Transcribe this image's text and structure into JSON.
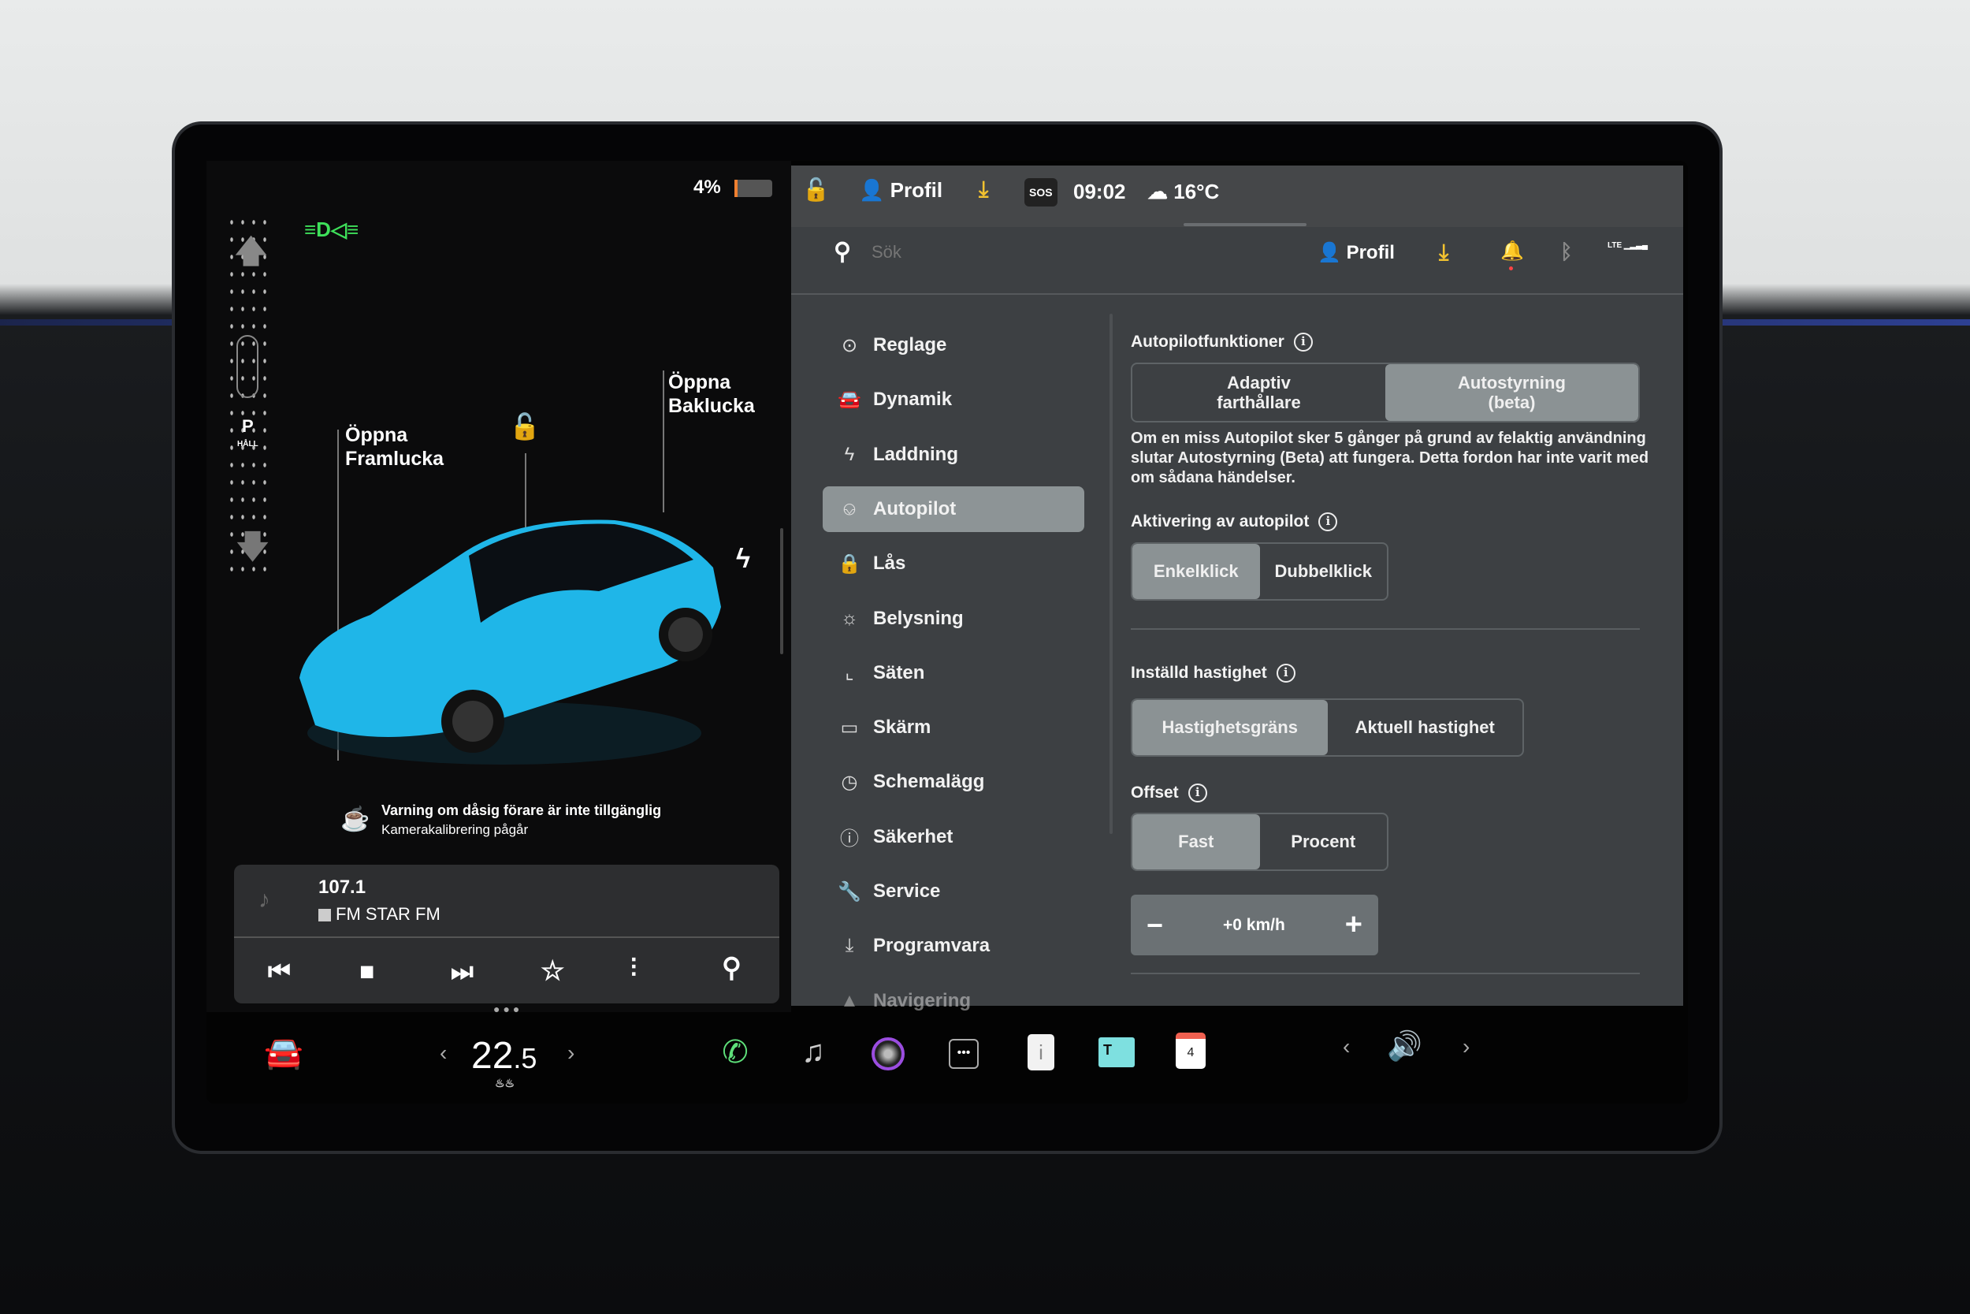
{
  "status": {
    "battery_percent": "4%",
    "battery_level": 4,
    "profile": "Profil",
    "time": "09:02",
    "temperature": "16°C",
    "sos": "SOS"
  },
  "gear": {
    "selected": "P",
    "hold": "HÅLL"
  },
  "car": {
    "front_trunk": [
      "Öppna",
      "Framlucka"
    ],
    "rear_trunk": [
      "Öppna",
      "Baklucka"
    ],
    "color": "#1fb6e8"
  },
  "warning": {
    "title": "Varning om dåsig förare är inte tillgänglig",
    "subtitle": "Kamerakalibrering pågår"
  },
  "media": {
    "frequency": "107.1",
    "station": "FM STAR FM"
  },
  "search": {
    "placeholder": "Sök"
  },
  "header": {
    "profile": "Profil",
    "lte": "LTE"
  },
  "menu": [
    {
      "label": "Reglage",
      "icon": "toggle-icon"
    },
    {
      "label": "Dynamik",
      "icon": "car-icon"
    },
    {
      "label": "Laddning",
      "icon": "bolt-icon"
    },
    {
      "label": "Autopilot",
      "icon": "steering-wheel-icon",
      "active": true
    },
    {
      "label": "Lås",
      "icon": "lock-icon"
    },
    {
      "label": "Belysning",
      "icon": "sun-icon"
    },
    {
      "label": "Säten",
      "icon": "seat-icon"
    },
    {
      "label": "Skärm",
      "icon": "display-icon"
    },
    {
      "label": "Schemalägg",
      "icon": "clock-icon"
    },
    {
      "label": "Säkerhet",
      "icon": "alert-icon"
    },
    {
      "label": "Service",
      "icon": "wrench-icon"
    },
    {
      "label": "Programvara",
      "icon": "download-icon"
    },
    {
      "label": "Navigering",
      "icon": "navigation-icon"
    }
  ],
  "autopilot": {
    "features_title": "Autopilotfunktioner",
    "features": [
      "Adaptiv farthållare",
      "Autostyrning (beta)"
    ],
    "features_selected": 1,
    "description": "Om en miss Autopilot sker 5 gånger på grund av felaktig användning slutar Autostyrning (Beta) att fungera. Detta fordon har inte varit med om sådana händelser.",
    "activation_title": "Aktivering av autopilot",
    "activation": [
      "Enkelklick",
      "Dubbelklick"
    ],
    "activation_selected": 0,
    "speed_title": "Inställd hastighet",
    "speed": [
      "Hastighetsgräns",
      "Aktuell hastighet"
    ],
    "speed_selected": 0,
    "offset_title": "Offset",
    "offset": [
      "Fast",
      "Procent"
    ],
    "offset_selected": 0,
    "offset_value": "+0 km/h"
  },
  "dock": {
    "temp_main": "22",
    "temp_decimal": ".5",
    "calendar_day": "4"
  },
  "colors": {
    "accent_yellow": "#f2c230",
    "panel": "#3d4043",
    "active": "#8d9496",
    "headlight_green": "#3ee05a"
  }
}
